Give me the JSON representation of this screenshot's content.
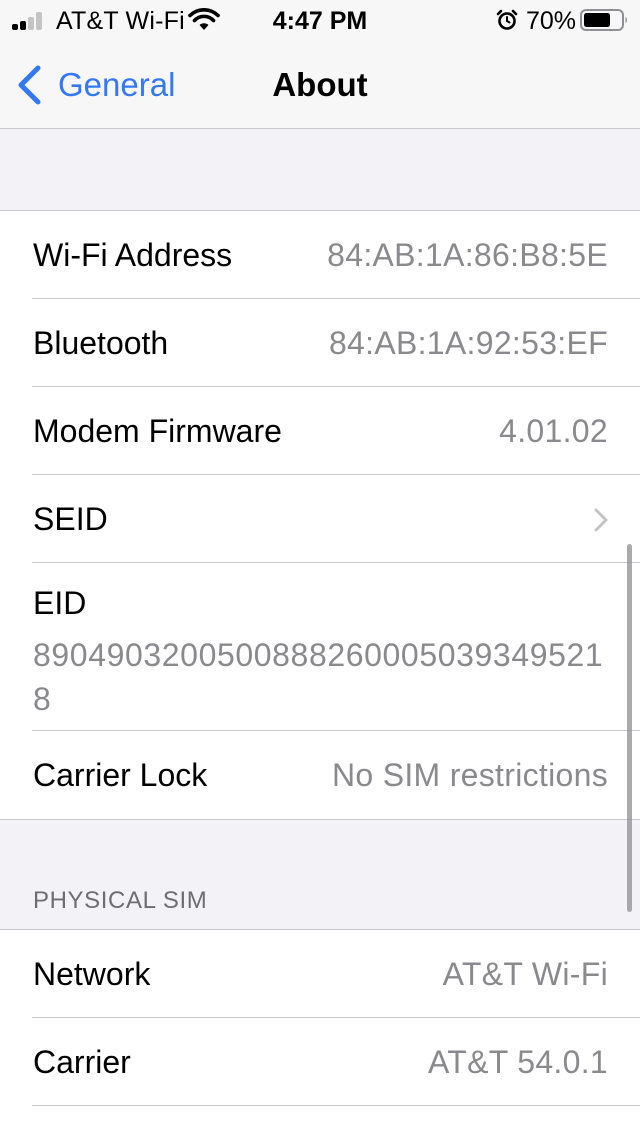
{
  "status_bar": {
    "carrier": "AT&T Wi-Fi",
    "time": "4:47 PM",
    "battery_percent": "70%",
    "signal_bars": 2,
    "battery_level": 0.7,
    "icons": [
      "signal-icon",
      "wifi-icon",
      "alarm-icon",
      "battery-icon"
    ]
  },
  "nav": {
    "back_label": "General",
    "title": "About"
  },
  "info_group": {
    "rows": [
      {
        "label": "Wi-Fi Address",
        "value": "84:AB:1A:86:B8:5E"
      },
      {
        "label": "Bluetooth",
        "value": "84:AB:1A:92:53:EF"
      },
      {
        "label": "Modem Firmware",
        "value": "4.01.02"
      },
      {
        "label": "SEID",
        "value": ""
      },
      {
        "label": "EID",
        "value": "89049032005008882600050393495218"
      },
      {
        "label": "Carrier Lock",
        "value": "No SIM restrictions"
      }
    ]
  },
  "physical_sim": {
    "header": "PHYSICAL SIM",
    "rows": [
      {
        "label": "Network",
        "value": "AT&T Wi-Fi"
      },
      {
        "label": "Carrier",
        "value": "AT&T 54.0.1"
      }
    ]
  },
  "colors": {
    "accent": "#3478f6",
    "background": "#f2f2f7",
    "secondary_text": "#8a8a8e",
    "separator": "#c8c7cc"
  }
}
